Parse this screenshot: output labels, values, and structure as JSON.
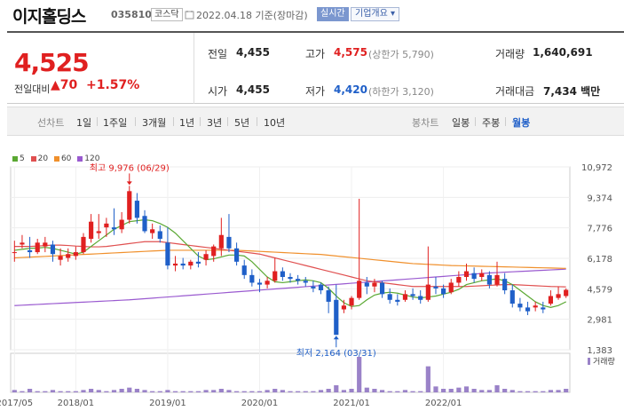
{
  "header": {
    "name": "이지홀딩스",
    "code": "035810",
    "market": "코스닥",
    "date": "2022.04.18 기준(장마감)",
    "realtime": "실시간",
    "company_btn": "기업개요 ▾"
  },
  "quote": {
    "price": "4,525",
    "change_label": "전일대비",
    "change_val": "▲70",
    "change_pct": "+1.57%",
    "prev_close_label": "전일",
    "prev_close": "4,455",
    "open_label": "시가",
    "open": "4,455",
    "high_label": "고가",
    "high": "4,575",
    "upper_limit": "(상한가 5,790)",
    "low_label": "저가",
    "low": "4,420",
    "lower_limit": "(하한가 3,120)",
    "volume_label": "거래량",
    "volume": "1,640,691",
    "amount_label": "거래대금",
    "amount": "7,434 백만"
  },
  "toolbar": {
    "line_chart": "선차트",
    "ranges": [
      "1일",
      "1주일",
      "3개월",
      "1년",
      "3년",
      "5년",
      "10년"
    ],
    "candle_chart": "봉차트",
    "periods": [
      "일봉",
      "주봉",
      "월봉"
    ],
    "active_period": "월봉"
  },
  "colors": {
    "up": "#e02020",
    "down": "#1f5fc8",
    "ma5": "#5aa832",
    "ma20": "#e05050",
    "ma60": "#f0902c",
    "ma120": "#9a5ad0",
    "volume": "#9a82c8"
  },
  "chart_data": {
    "type": "candlestick",
    "period": "monthly",
    "legend": [
      "5",
      "20",
      "60",
      "120"
    ],
    "y_ticks": [
      10972,
      9374,
      7776,
      6178,
      4579,
      2981,
      1383
    ],
    "ylim": [
      1383,
      10972
    ],
    "x_ticks": [
      "2017/05",
      "2018/01",
      "2019/01",
      "2020/01",
      "2021/01",
      "2022/01"
    ],
    "annotations": {
      "max": {
        "label": "최고 9,976 (06/29)",
        "value": 9976
      },
      "min": {
        "label": "최저 2,164 (03/31)",
        "value": 2164
      }
    },
    "volume_label": "거래량",
    "candles": [
      [
        6500,
        7100,
        6500,
        6000
      ],
      [
        6900,
        7400,
        7000,
        6700
      ],
      [
        6600,
        7300,
        6500,
        6200
      ],
      [
        6500,
        7200,
        7000,
        6400
      ],
      [
        6800,
        7300,
        7000,
        6500
      ],
      [
        6900,
        7100,
        6400,
        6000
      ],
      [
        6100,
        6700,
        6300,
        5800
      ],
      [
        6200,
        6700,
        6400,
        6000
      ],
      [
        6300,
        6800,
        6500,
        6100
      ],
      [
        6500,
        7500,
        7300,
        6400
      ],
      [
        7200,
        8500,
        8100,
        7000
      ],
      [
        7500,
        8500,
        7600,
        7200
      ],
      [
        7800,
        8300,
        8000,
        7300
      ],
      [
        7800,
        8800,
        7700,
        7400
      ],
      [
        7700,
        8600,
        8200,
        7500
      ],
      [
        8200,
        9976,
        9700,
        8000
      ],
      [
        9200,
        9600,
        8300,
        8000
      ],
      [
        8400,
        8700,
        7600,
        7500
      ],
      [
        7500,
        8000,
        7700,
        7200
      ],
      [
        7600,
        7900,
        7200,
        7000
      ],
      [
        7000,
        7800,
        5800,
        5600
      ],
      [
        5800,
        6300,
        5900,
        5500
      ],
      [
        5900,
        6200,
        5800,
        5600
      ],
      [
        5800,
        6100,
        6000,
        5600
      ],
      [
        6000,
        6500,
        5900,
        5700
      ],
      [
        6100,
        6600,
        6400,
        5800
      ],
      [
        6300,
        6900,
        6800,
        6000
      ],
      [
        6700,
        8300,
        7400,
        6300
      ],
      [
        7300,
        8500,
        6700,
        6500
      ],
      [
        6700,
        7000,
        6000,
        5800
      ],
      [
        5800,
        6100,
        5300,
        5100
      ],
      [
        5300,
        5600,
        4900,
        4700
      ],
      [
        4900,
        5100,
        4800,
        4400
      ],
      [
        4800,
        5200,
        5000,
        4600
      ],
      [
        5000,
        6200,
        5500,
        4900
      ],
      [
        5500,
        5700,
        5200,
        5000
      ],
      [
        5200,
        5400,
        5100,
        4900
      ],
      [
        5100,
        5300,
        5000,
        4800
      ],
      [
        5000,
        5200,
        4900,
        4700
      ],
      [
        4700,
        5000,
        4600,
        4400
      ],
      [
        4800,
        4900,
        4500,
        4300
      ],
      [
        4500,
        4700,
        3900,
        3300
      ],
      [
        4000,
        4800,
        2164,
        2164
      ],
      [
        3500,
        4000,
        3700,
        3300
      ],
      [
        3700,
        4200,
        4100,
        3500
      ],
      [
        4100,
        9300,
        5000,
        4000
      ],
      [
        4900,
        5200,
        4700,
        4300
      ],
      [
        4700,
        5100,
        4900,
        4400
      ],
      [
        4900,
        5000,
        4300,
        4100
      ],
      [
        4300,
        4600,
        4000,
        3800
      ],
      [
        4000,
        4300,
        3900,
        3700
      ],
      [
        4000,
        4500,
        4300,
        3900
      ],
      [
        4300,
        4600,
        4200,
        4000
      ],
      [
        4200,
        4500,
        4000,
        3800
      ],
      [
        4000,
        6800,
        4800,
        3900
      ],
      [
        4700,
        5200,
        4600,
        4300
      ],
      [
        4600,
        4800,
        4300,
        4100
      ],
      [
        4400,
        5100,
        4900,
        4300
      ],
      [
        4900,
        5500,
        5200,
        4700
      ],
      [
        5200,
        5900,
        5500,
        5000
      ],
      [
        5400,
        5700,
        5100,
        4900
      ],
      [
        5200,
        5600,
        5400,
        5000
      ],
      [
        5300,
        5500,
        4800,
        4600
      ],
      [
        4800,
        6000,
        5300,
        4700
      ],
      [
        5100,
        5400,
        4500,
        4300
      ],
      [
        4500,
        4800,
        3800,
        3600
      ],
      [
        3800,
        4100,
        3600,
        3400
      ],
      [
        3600,
        3900,
        3400,
        3200
      ],
      [
        3600,
        3900,
        3700,
        3400
      ],
      [
        3600,
        3900,
        3500,
        3300
      ],
      [
        3800,
        4500,
        4200,
        3700
      ],
      [
        4100,
        4700,
        4300,
        4000
      ],
      [
        4200,
        4600,
        4525,
        4100
      ]
    ],
    "ma5": [
      6600,
      6650,
      6700,
      6720,
      6750,
      6700,
      6600,
      6500,
      6400,
      6500,
      6800,
      7100,
      7400,
      7700,
      7900,
      8100,
      8150,
      8200,
      8150,
      8000,
      7800,
      7500,
      7100,
      6700,
      6300,
      6100,
      6150,
      6250,
      6350,
      6350,
      6300,
      6000,
      5600,
      5200,
      4950,
      4900,
      4950,
      5000,
      5050,
      5000,
      4900,
      4600,
      4200,
      3850,
      3650,
      3700,
      4000,
      4250,
      4350,
      4400,
      4350,
      4250,
      4150,
      4100,
      4150,
      4200,
      4300,
      4400,
      4550,
      4800,
      4900,
      5000,
      5050,
      5100,
      5000,
      4800,
      4500,
      4200,
      3900,
      3700,
      3600,
      3700,
      3900
    ],
    "ma20": [
      6800,
      6800,
      6800,
      6820,
      6850,
      6870,
      6870,
      6850,
      6820,
      6800,
      6780,
      6780,
      6800,
      6850,
      6900,
      6950,
      7000,
      7050,
      7050,
      7050,
      7000,
      6950,
      6900,
      6850,
      6800,
      6750,
      6700,
      6650,
      6600,
      6550,
      6500,
      6450,
      6400,
      6300,
      6200,
      6100,
      6000,
      5900,
      5800,
      5700,
      5600,
      5500,
      5400,
      5300,
      5200,
      5100,
      5000,
      4950,
      4900,
      4850,
      4800,
      4750,
      4700,
      4700,
      4700,
      4700,
      4700,
      4700,
      4700,
      4700,
      4720,
      4740,
      4760,
      4780,
      4800,
      4800,
      4780,
      4760,
      4740,
      4720,
      4700,
      4690,
      4680
    ],
    "ma60": [
      6200,
      6220,
      6240,
      6260,
      6280,
      6300,
      6320,
      6340,
      6360,
      6380,
      6400,
      6420,
      6440,
      6460,
      6480,
      6500,
      6520,
      6540,
      6560,
      6580,
      6600,
      6600,
      6600,
      6600,
      6600,
      6600,
      6600,
      6600,
      6600,
      6600,
      6580,
      6560,
      6540,
      6520,
      6500,
      6480,
      6460,
      6440,
      6420,
      6400,
      6380,
      6340,
      6300,
      6260,
      6220,
      6180,
      6140,
      6100,
      6060,
      6020,
      5980,
      5940,
      5900,
      5880,
      5860,
      5840,
      5820,
      5800,
      5790,
      5780,
      5770,
      5760,
      5750,
      5740,
      5730,
      5720,
      5710,
      5700,
      5690,
      5680,
      5670,
      5660,
      5650
    ],
    "ma120": [
      3700,
      3720,
      3740,
      3760,
      3780,
      3800,
      3820,
      3840,
      3860,
      3880,
      3900,
      3920,
      3940,
      3960,
      3980,
      4000,
      4030,
      4060,
      4090,
      4120,
      4150,
      4180,
      4210,
      4240,
      4270,
      4300,
      4330,
      4360,
      4390,
      4420,
      4450,
      4480,
      4510,
      4540,
      4570,
      4600,
      4630,
      4660,
      4690,
      4720,
      4750,
      4780,
      4810,
      4840,
      4870,
      4900,
      4930,
      4960,
      4990,
      5020,
      5050,
      5080,
      5110,
      5140,
      5170,
      5200,
      5230,
      5260,
      5290,
      5320,
      5350,
      5380,
      5410,
      5430,
      5450,
      5470,
      5490,
      5510,
      5530,
      5550,
      5570,
      5590,
      5610
    ],
    "volumes": [
      2,
      1,
      3,
      1,
      1,
      2,
      1,
      1,
      1,
      2,
      3,
      2,
      1,
      2,
      3,
      4,
      3,
      2,
      1,
      1,
      2,
      1,
      1,
      1,
      1,
      2,
      2,
      3,
      2,
      1,
      1,
      1,
      1,
      2,
      3,
      2,
      1,
      1,
      1,
      1,
      2,
      3,
      6,
      2,
      3,
      30,
      4,
      3,
      2,
      1,
      1,
      2,
      1,
      1,
      22,
      5,
      3,
      3,
      4,
      5,
      3,
      2,
      2,
      6,
      3,
      2,
      1,
      1,
      1,
      1,
      2,
      2,
      3
    ]
  }
}
